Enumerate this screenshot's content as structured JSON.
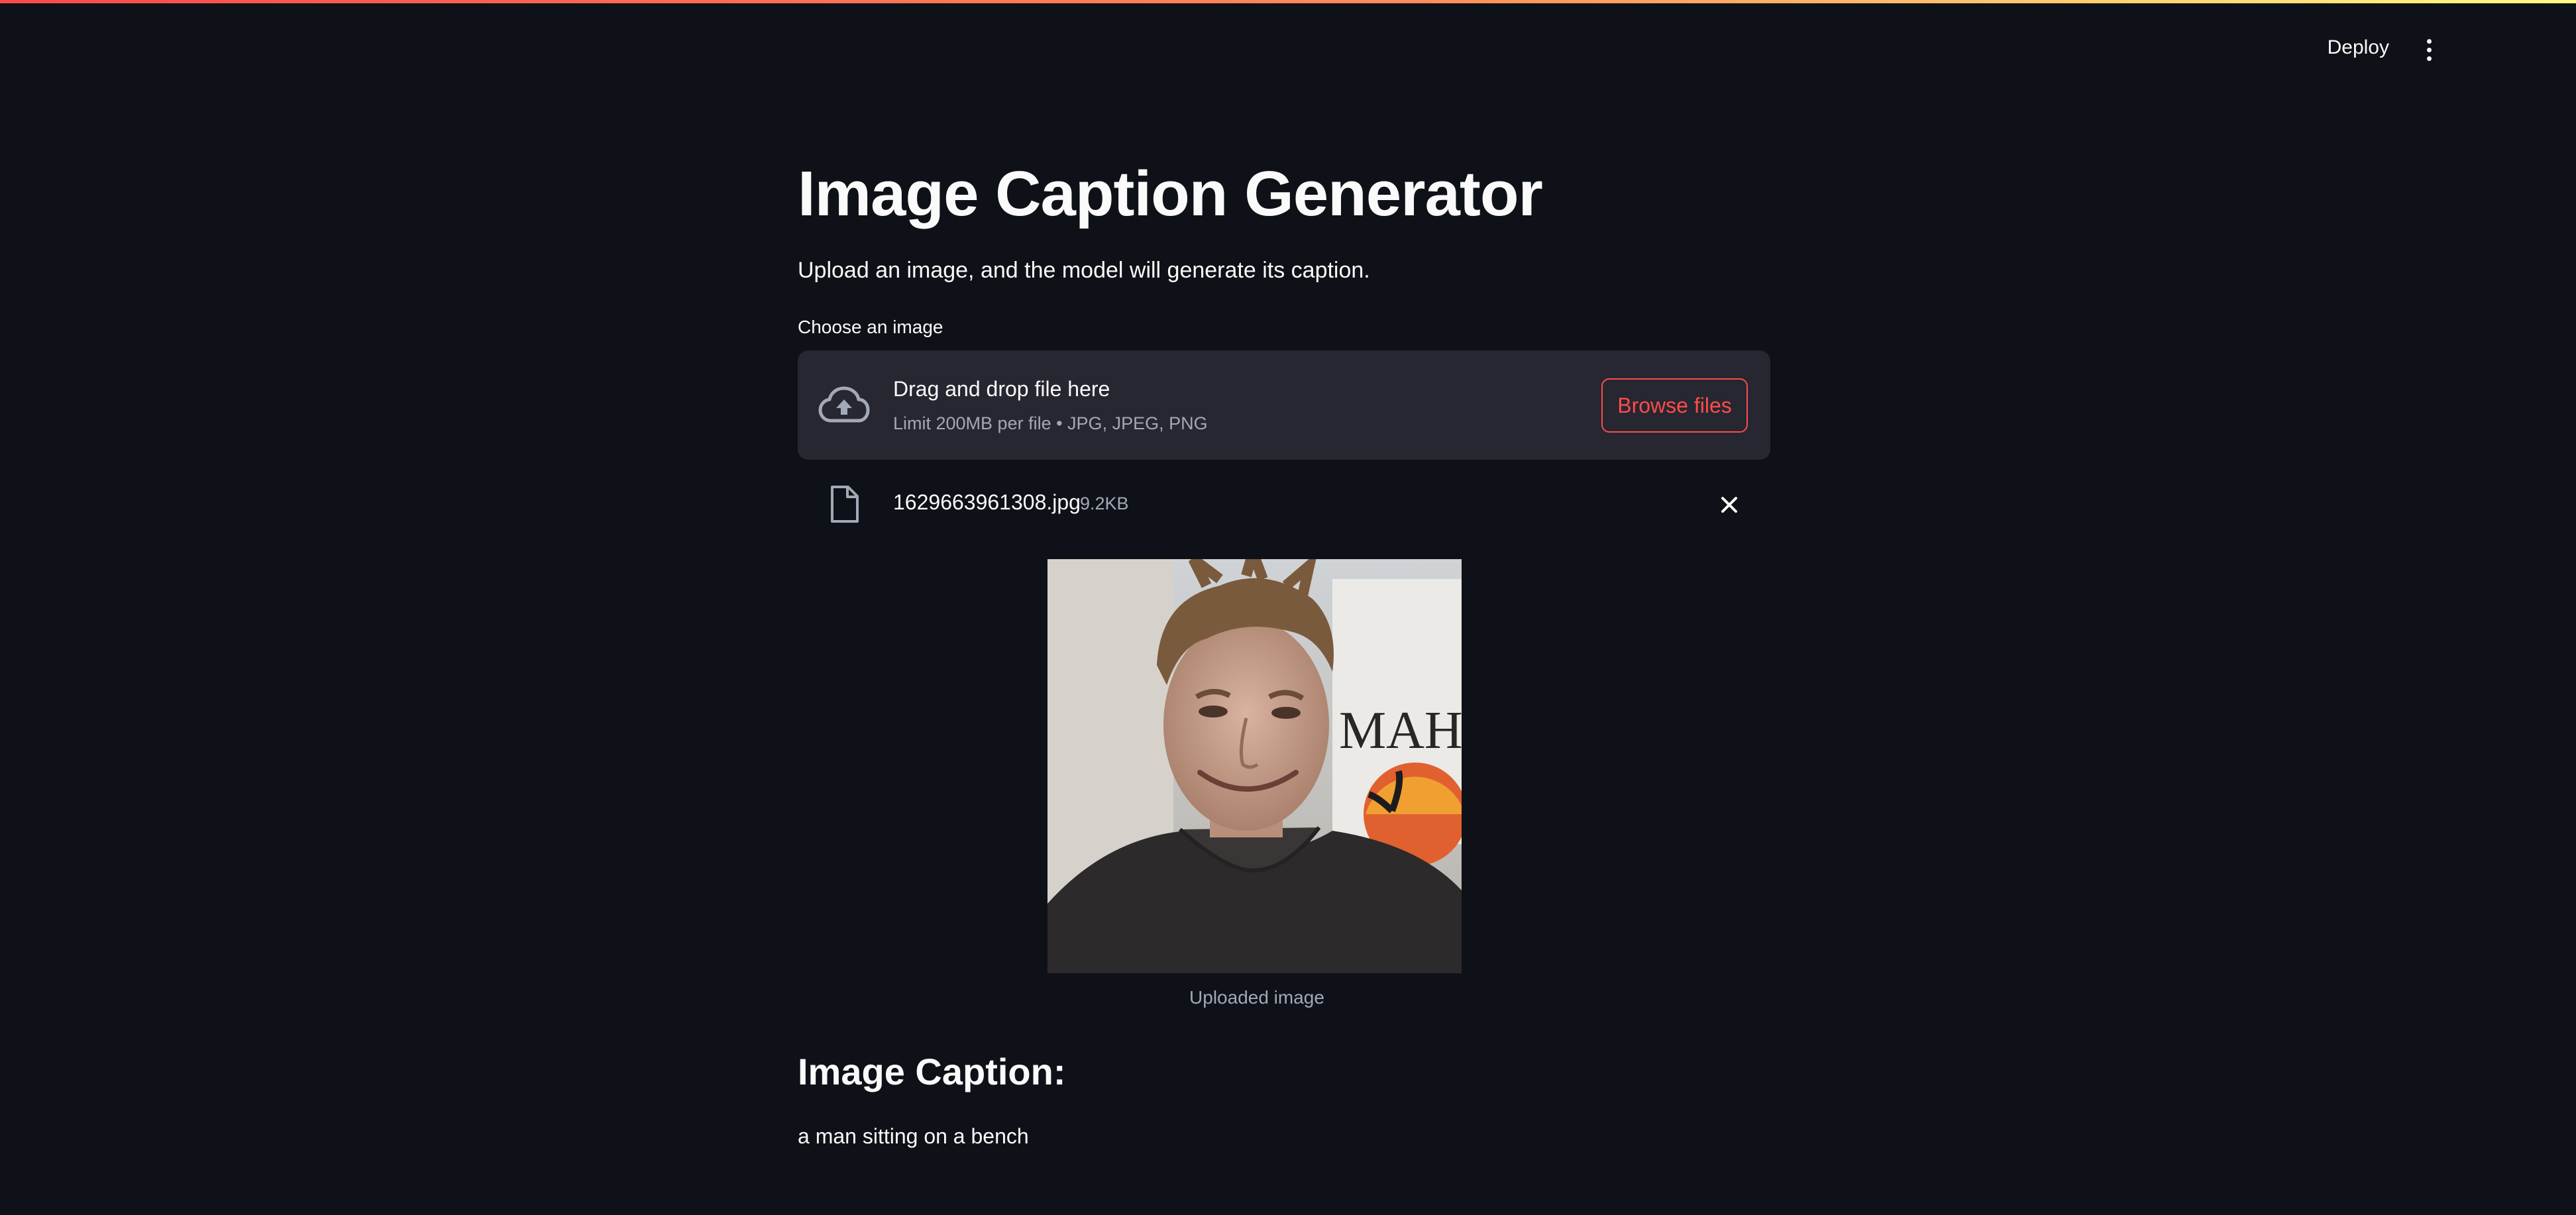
{
  "header": {
    "deploy_label": "Deploy",
    "menu_icon": "vertical-ellipsis-icon"
  },
  "page": {
    "title": "Image Caption Generator",
    "subtitle": "Upload an image, and the model will generate its caption."
  },
  "uploader": {
    "label": "Choose an image",
    "drop_title": "Drag and drop file here",
    "drop_subtitle": "Limit 200MB per file • JPG, JPEG, PNG",
    "browse_label": "Browse files",
    "upload_icon": "cloud-upload-icon"
  },
  "file": {
    "name": "1629663961308.jpg",
    "size": "9.2KB",
    "file_icon": "document-icon",
    "remove_icon": "close-icon"
  },
  "image": {
    "caption": "Uploaded image"
  },
  "result": {
    "heading": "Image Caption:",
    "text": "a man sitting on a bench"
  },
  "colors": {
    "background": "#0e1117",
    "surface": "#262730",
    "accent": "#ff4b4b",
    "muted_text": "#a3a8b8"
  }
}
